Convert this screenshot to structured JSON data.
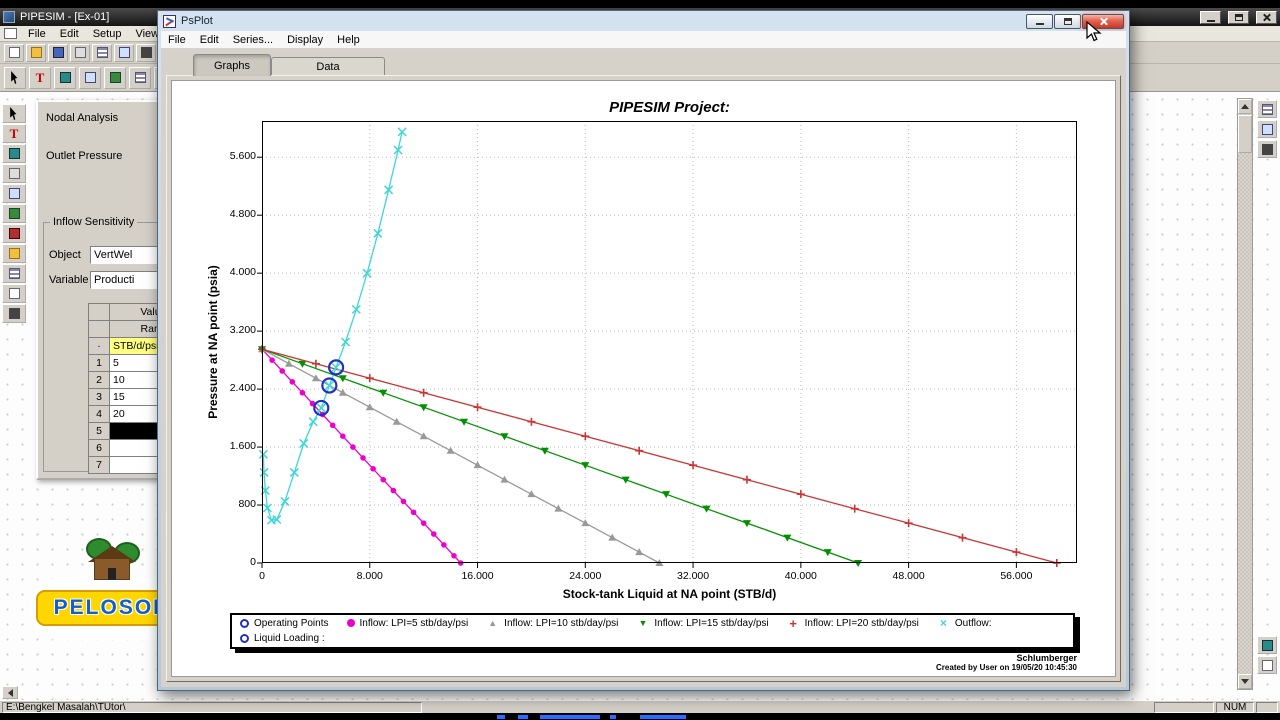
{
  "main_window": {
    "title": "PIPESIM - [Ex-01]",
    "menus": [
      "File",
      "Edit",
      "Setup",
      "View"
    ],
    "status_path": "E:\\Bengkel Masalah\\TUtor\\",
    "num_label": "NUM"
  },
  "icons": {
    "text_tool": "T"
  },
  "logo": {
    "text": "PELOSOK"
  },
  "nodal_dialog": {
    "title": "Nodal Analysis",
    "outlet_label": "Outlet Pressure",
    "group_label": "Inflow Sensitivity",
    "object_label": "Object",
    "object_value": "VertWel",
    "variable_label": "Variable",
    "variable_value": "Producti",
    "col_header": "Values",
    "range_label": "Range",
    "corner_label": "·",
    "unit_label": "STB/d/psi",
    "rows": [
      {
        "n": "1",
        "value": "5"
      },
      {
        "n": "2",
        "value": "10"
      },
      {
        "n": "3",
        "value": "15"
      },
      {
        "n": "4",
        "value": "20"
      },
      {
        "n": "5",
        "value": "",
        "selected": true
      },
      {
        "n": "6",
        "value": ""
      },
      {
        "n": "7",
        "value": ""
      }
    ]
  },
  "psplot": {
    "title": "PsPlot",
    "menus": [
      "File",
      "Edit",
      "Series...",
      "Display",
      "Help"
    ],
    "tabs": [
      {
        "label": "Graphs",
        "active": true
      },
      {
        "label": "Data",
        "active": false
      }
    ],
    "footer_brand": "Schlumberger",
    "footer_created": "Created by User on 19/05/20 10:45:30"
  },
  "chart_data": {
    "type": "line",
    "title": "PIPESIM Project:",
    "xlabel": "Stock-tank Liquid at NA point (STB/d)",
    "ylabel": "Pressure at NA point (psia)",
    "xlim": [
      0,
      60500
    ],
    "ylim": [
      0,
      6100
    ],
    "grid": "dotted",
    "legend_position": "bottom",
    "x_ticks": [
      0,
      8000,
      16000,
      24000,
      32000,
      40000,
      48000,
      56000
    ],
    "x_tick_labels": [
      "0",
      "8.000",
      "16.000",
      "24.000",
      "32.000",
      "40.000",
      "48.000",
      "56.000"
    ],
    "y_ticks": [
      0,
      800,
      1600,
      2400,
      3200,
      4000,
      4800,
      5600
    ],
    "y_tick_labels": [
      "0",
      "800",
      "1.600",
      "2.400",
      "3.200",
      "4.000",
      "4.800",
      "5.600"
    ],
    "series": [
      {
        "name": "Inflow: LPI=5 stb/day/psi",
        "color": "#ee00cc",
        "marker": "circle",
        "points": [
          [
            0,
            2950
          ],
          [
            750,
            2800
          ],
          [
            1500,
            2650
          ],
          [
            2250,
            2500
          ],
          [
            3000,
            2350
          ],
          [
            3750,
            2200
          ],
          [
            4500,
            2050
          ],
          [
            5250,
            1900
          ],
          [
            6000,
            1750
          ],
          [
            6750,
            1600
          ],
          [
            7500,
            1450
          ],
          [
            8250,
            1300
          ],
          [
            9000,
            1150
          ],
          [
            9750,
            1000
          ],
          [
            10500,
            850
          ],
          [
            11250,
            700
          ],
          [
            12000,
            550
          ],
          [
            12750,
            400
          ],
          [
            13500,
            250
          ],
          [
            14250,
            100
          ],
          [
            14750,
            0
          ]
        ]
      },
      {
        "name": "Inflow: LPI=10 stb/day/psi",
        "color": "#999999",
        "marker": "triangle-up",
        "points": [
          [
            0,
            2950
          ],
          [
            2000,
            2750
          ],
          [
            4000,
            2550
          ],
          [
            6000,
            2350
          ],
          [
            8000,
            2150
          ],
          [
            10000,
            1950
          ],
          [
            12000,
            1750
          ],
          [
            14000,
            1550
          ],
          [
            16000,
            1350
          ],
          [
            18000,
            1150
          ],
          [
            20000,
            950
          ],
          [
            22000,
            750
          ],
          [
            24000,
            550
          ],
          [
            26000,
            350
          ],
          [
            28000,
            150
          ],
          [
            29500,
            0
          ]
        ]
      },
      {
        "name": "Inflow: LPI=15 stb/day/psi",
        "color": "#009000",
        "marker": "triangle-down",
        "points": [
          [
            0,
            2950
          ],
          [
            3000,
            2750
          ],
          [
            6000,
            2550
          ],
          [
            9000,
            2350
          ],
          [
            12000,
            2150
          ],
          [
            15000,
            1950
          ],
          [
            18000,
            1750
          ],
          [
            21000,
            1550
          ],
          [
            24000,
            1350
          ],
          [
            27000,
            1150
          ],
          [
            30000,
            950
          ],
          [
            33000,
            750
          ],
          [
            36000,
            550
          ],
          [
            39000,
            350
          ],
          [
            42000,
            150
          ],
          [
            44250,
            0
          ]
        ]
      },
      {
        "name": "Inflow: LPI=20 stb/day/psi",
        "color": "#cc3333",
        "marker": "plus",
        "points": [
          [
            0,
            2950
          ],
          [
            4000,
            2750
          ],
          [
            8000,
            2550
          ],
          [
            12000,
            2350
          ],
          [
            16000,
            2150
          ],
          [
            20000,
            1950
          ],
          [
            24000,
            1750
          ],
          [
            28000,
            1550
          ],
          [
            32000,
            1350
          ],
          [
            36000,
            1150
          ],
          [
            40000,
            950
          ],
          [
            44000,
            750
          ],
          [
            48000,
            550
          ],
          [
            52000,
            350
          ],
          [
            56000,
            150
          ],
          [
            59000,
            0
          ]
        ]
      },
      {
        "name": "Outflow:",
        "color": "#3fd6d6",
        "marker": "x",
        "points": [
          [
            100,
            1500
          ],
          [
            150,
            1250
          ],
          [
            250,
            1000
          ],
          [
            400,
            760
          ],
          [
            700,
            590
          ],
          [
            1100,
            600
          ],
          [
            1700,
            850
          ],
          [
            2400,
            1250
          ],
          [
            3100,
            1650
          ],
          [
            3800,
            1950
          ],
          [
            4400,
            2140
          ],
          [
            5000,
            2450
          ],
          [
            5500,
            2700
          ],
          [
            6200,
            3050
          ],
          [
            7000,
            3500
          ],
          [
            7800,
            4000
          ],
          [
            8600,
            4550
          ],
          [
            9400,
            5150
          ],
          [
            10100,
            5700
          ],
          [
            10400,
            5950
          ]
        ]
      }
    ],
    "operating_points": {
      "name": "Operating Points",
      "color": "#2030c0",
      "points": [
        [
          4400,
          2140
        ],
        [
          5000,
          2450
        ],
        [
          5500,
          2700
        ]
      ]
    },
    "legend_row2": [
      {
        "name": "Liquid Loading :",
        "color": "#2233bb",
        "marker": "circle-open"
      }
    ]
  }
}
